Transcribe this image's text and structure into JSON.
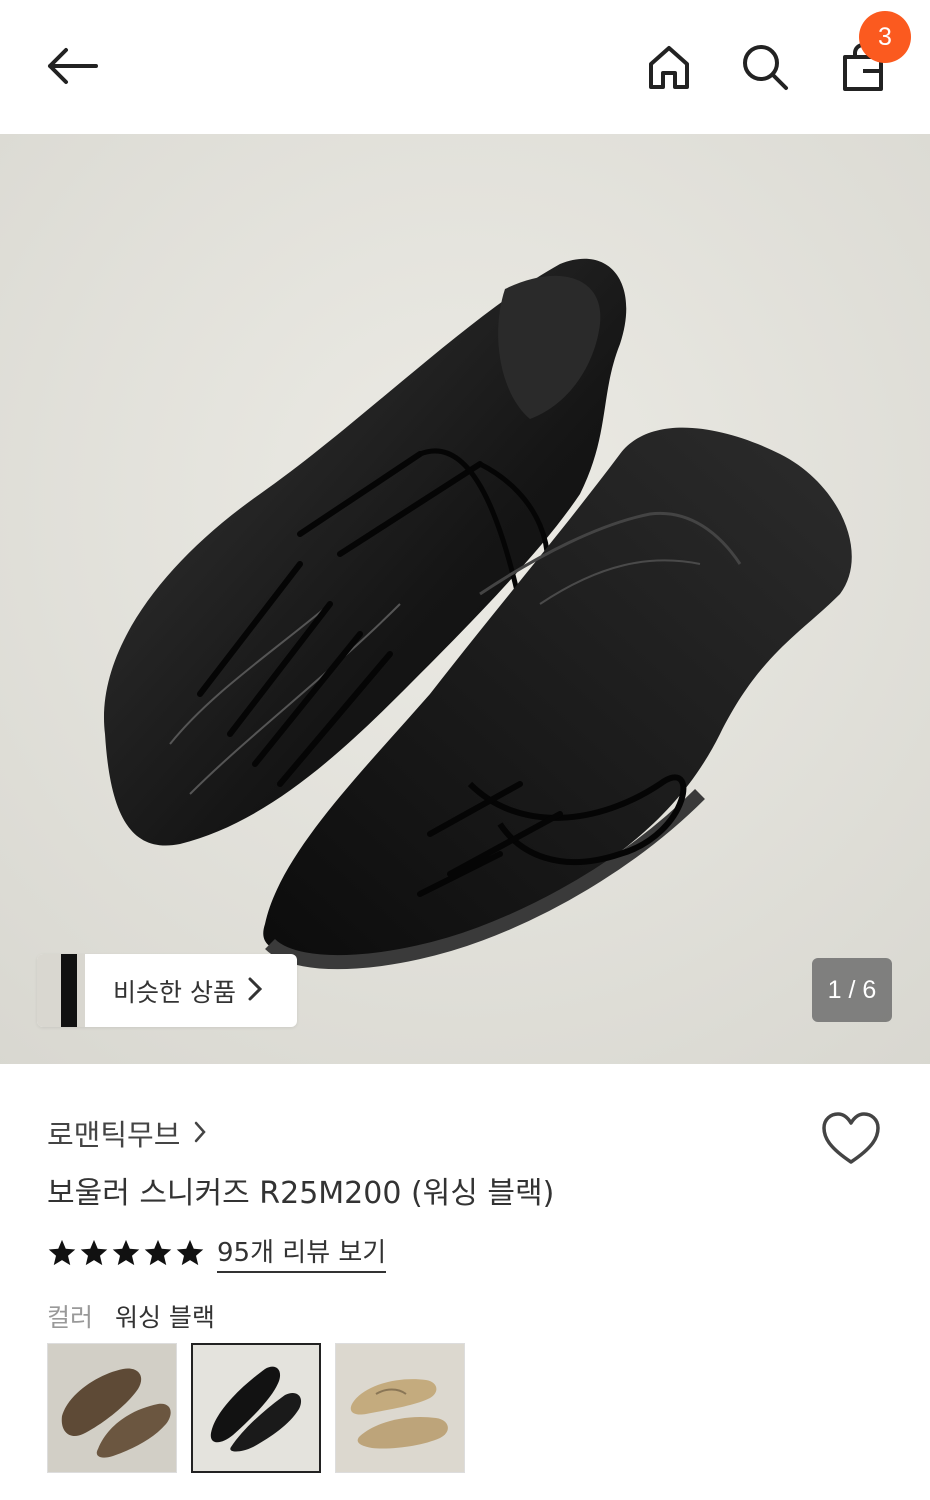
{
  "header": {
    "icons": [
      "back-arrow-icon",
      "home-icon",
      "search-icon",
      "shopping-bag-icon"
    ],
    "cart_badge": "3",
    "badge_color": "#fb5a1f"
  },
  "gallery": {
    "similar_label": "비슷한 상품",
    "counter": "1 / 6"
  },
  "product": {
    "brand": "로맨틱무브",
    "name": "보울러 스니커즈 R25M200 (워싱 블랙)",
    "rating_stars": 5,
    "review_link": "95개 리뷰 보기",
    "option_key": "컬러",
    "option_value": "워싱 블랙",
    "swatches": [
      "brown suede",
      "black leather",
      "beige"
    ],
    "selected_swatch": 1
  }
}
